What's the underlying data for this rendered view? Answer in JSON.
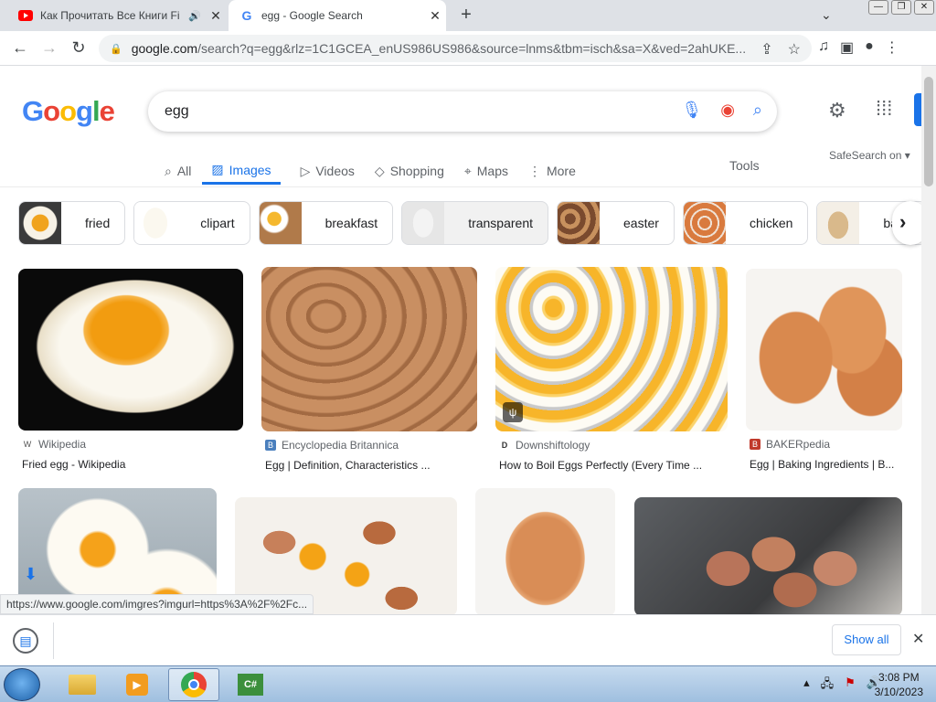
{
  "browser": {
    "tabs": [
      {
        "title": "Как Прочитать Все Книги Fi",
        "favicon": "youtube-icon",
        "audio": true
      },
      {
        "title": "egg - Google Search",
        "favicon": "google-icon",
        "active": true
      }
    ],
    "url_host": "google.com",
    "url_rest": "/search?q=egg&rlz=1C1GCEA_enUS986US986&source=lnms&tbm=isch&sa=X&ved=2ahUKE...",
    "status_url": "https://www.google.com/imgres?imgurl=https%3A%2F%2Fc..."
  },
  "search": {
    "query": "egg",
    "nav_tabs": [
      {
        "label": "All",
        "icon": "search-icon"
      },
      {
        "label": "Images",
        "icon": "image-icon",
        "active": true
      },
      {
        "label": "Videos",
        "icon": "play-icon"
      },
      {
        "label": "Shopping",
        "icon": "tag-icon"
      },
      {
        "label": "Maps",
        "icon": "pin-icon"
      },
      {
        "label": "More",
        "icon": "more-vert-icon"
      }
    ],
    "tools_label": "Tools",
    "safesearch_label": "SafeSearch on"
  },
  "chips": [
    {
      "label": "fried",
      "color": "#e8b030"
    },
    {
      "label": "clipart",
      "color": "#f2efe4"
    },
    {
      "label": "breakfast",
      "color": "#f4c86a"
    },
    {
      "label": "transparent",
      "color": "#ececec"
    },
    {
      "label": "easter",
      "color": "#a86c4a"
    },
    {
      "label": "chicken",
      "color": "#d9874e"
    },
    {
      "label": "baby",
      "color": "#d9b98b"
    }
  ],
  "results": [
    {
      "source": "Wikipedia",
      "title": "Fried egg - Wikipedia",
      "favicon": "W",
      "fav_color": "#555555"
    },
    {
      "source": "Encyclopedia Britannica",
      "title": "Egg | Definition, Characteristics ...",
      "favicon": "B",
      "fav_color": "#4a7fbd"
    },
    {
      "source": "Downshiftology",
      "title": "How to Boil Eggs Perfectly (Every Time ...",
      "favicon": "D",
      "fav_color": "#333333"
    },
    {
      "source": "BAKERpedia",
      "title": "Egg | Baking Ingredients | B...",
      "favicon": "B",
      "fav_color": "#c0392b"
    }
  ],
  "download_bar": {
    "show_all_label": "Show all"
  },
  "taskbar": {
    "time": "3:08 PM",
    "date": "3/10/2023"
  }
}
